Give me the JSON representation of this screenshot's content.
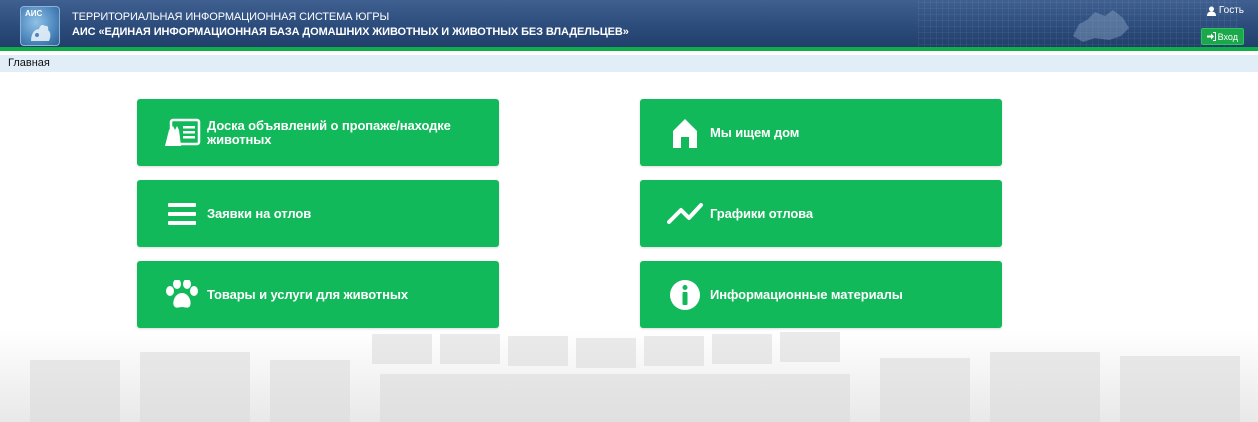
{
  "header": {
    "logo_text": "АИС",
    "title_line1": "ТЕРРИТОРИАЛЬНАЯ ИНФОРМАЦИОННАЯ СИСТЕМА ЮГРЫ",
    "title_line2": "АИС «ЕДИНАЯ ИНФОРМАЦИОННАЯ БАЗА ДОМАШНИХ ЖИВОТНЫХ И ЖИВОТНЫХ БЕЗ ВЛАДЕЛЬЦЕВ»",
    "user_label": "Гость",
    "login_label": "Вход"
  },
  "breadcrumb": {
    "current": "Главная"
  },
  "cards": [
    {
      "label": "Доска объявлений о пропаже/находке животных",
      "icon": "ad-board-icon"
    },
    {
      "label": "Мы ищем дом",
      "icon": "house-icon"
    },
    {
      "label": "Заявки на отлов",
      "icon": "list-icon"
    },
    {
      "label": "Графики отлова",
      "icon": "chart-line-icon"
    },
    {
      "label": "Товары и услуги для животных",
      "icon": "paw-icon"
    },
    {
      "label": "Информационные материалы",
      "icon": "info-icon"
    }
  ],
  "colors": {
    "header_bg": "#2c4c7c",
    "accent_green": "#12b95a",
    "breadcrumb_bg": "#e1edf7"
  }
}
